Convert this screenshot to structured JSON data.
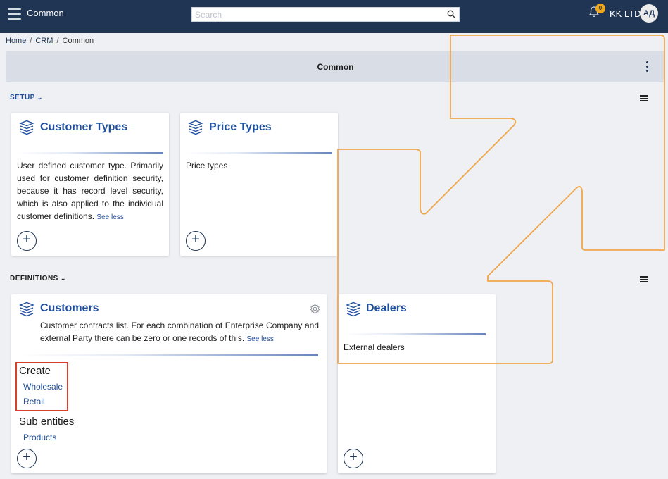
{
  "header": {
    "app_title": "Common",
    "search_placeholder": "Search",
    "notification_count": "0",
    "company": "KK LTD",
    "avatar_initials": "АД"
  },
  "breadcrumb": {
    "home": "Home",
    "crm": "CRM",
    "current": "Common"
  },
  "page": {
    "title": "Common"
  },
  "sections": {
    "setup": "SETUP",
    "definitions": "DEFINITIONS"
  },
  "cards": {
    "customer_types": {
      "title": "Customer Types",
      "description": "User defined customer type. Primarily used for customer definition security, because it has record level security, which is also applied to the individual customer definitions.",
      "see_less": "See less"
    },
    "price_types": {
      "title": "Price Types",
      "description": "Price types"
    },
    "customers": {
      "title": "Customers",
      "description": "Customer contracts list. For each combination of Enterprise Company and external Party there can be zero or one records of this.",
      "see_less": "See less",
      "create_title": "Create",
      "create_links": [
        "Wholesale",
        "Retail"
      ],
      "sub_entities_title": "Sub entities",
      "sub_links": [
        "Products"
      ]
    },
    "dealers": {
      "title": "Dealers",
      "description": "External dealers"
    }
  },
  "colors": {
    "topbar": "#1f3553",
    "accent": "#1f4e9c",
    "badge": "#f0a81b",
    "highlight": "#d9402b",
    "overlay_line": "#f0a64a"
  }
}
